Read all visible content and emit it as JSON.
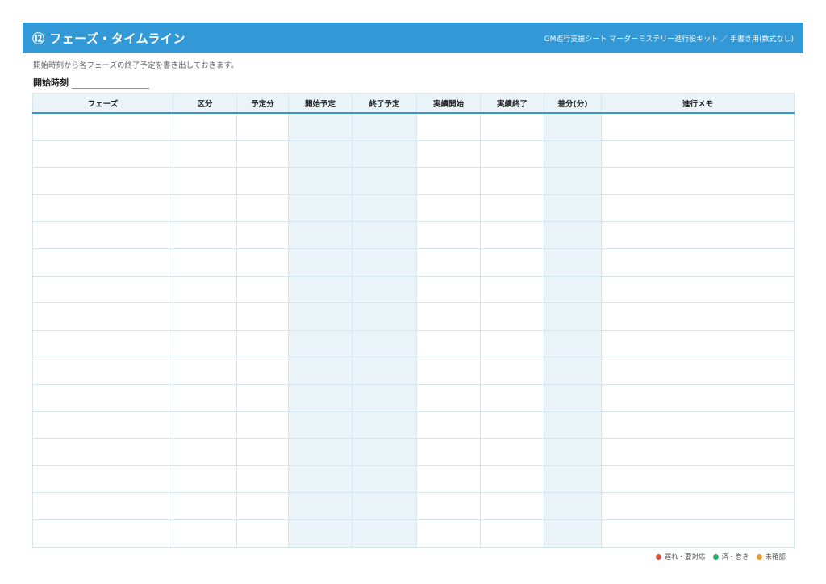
{
  "header": {
    "title": "⑫ フェーズ・タイムライン",
    "subtitle": "GM進行支援シート マーダーミステリー進行役キット ／ 手書き用(数式なし)"
  },
  "description": "開始時刻から各フェーズの終了予定を書き出しておきます。",
  "start_time": {
    "label": "開始時刻"
  },
  "table": {
    "columns": [
      "フェーズ",
      "区分",
      "予定分",
      "開始予定",
      "終了予定",
      "実績開始",
      "実績終了",
      "差分(分)",
      "進行メモ"
    ],
    "row_count": 16
  },
  "legend": [
    {
      "label": "遅れ・要対応",
      "color": "#e0533d"
    },
    {
      "label": "済・巻き",
      "color": "#2eac67"
    },
    {
      "label": "未確認",
      "color": "#e89c2a"
    }
  ],
  "colors": {
    "header_bg": "#3399d6",
    "shaded_column": "#eaf3f7"
  }
}
